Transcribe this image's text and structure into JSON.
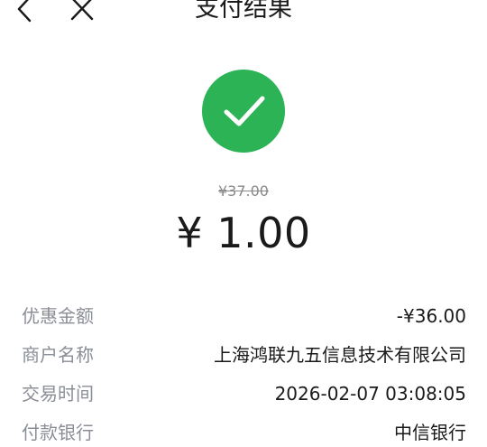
{
  "header": {
    "title": "支付结果"
  },
  "result": {
    "original_price": "¥37.00",
    "paid_amount": "¥ 1.00",
    "status_color": "#2bb356"
  },
  "details": [
    {
      "label": "优惠金额",
      "value": "-¥36.00"
    },
    {
      "label": "商户名称",
      "value": "上海鸿联九五信息技术有限公司"
    },
    {
      "label": "交易时间",
      "value": "2026-02-07 03:08:05"
    },
    {
      "label": "付款银行",
      "value": "中信银行"
    }
  ],
  "icons": {
    "back": "chevron-left-icon",
    "close": "close-icon",
    "success": "check-circle-icon"
  }
}
